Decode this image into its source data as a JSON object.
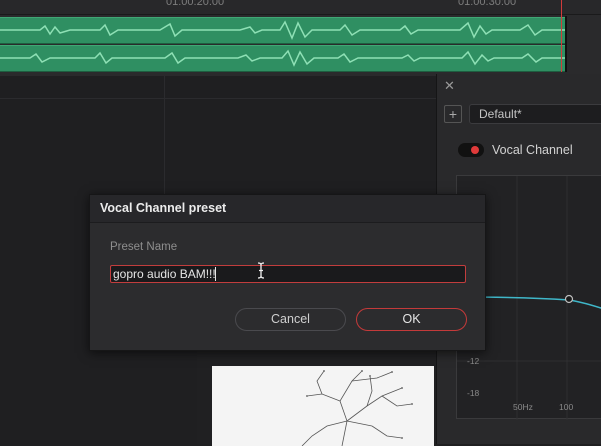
{
  "timeline": {
    "timecodes": [
      "01:00:20:00",
      "01:00:30:00"
    ],
    "track_color": "#2f8f62",
    "playhead_color": "#d03b3b"
  },
  "eq_panel": {
    "close_glyph": "✕",
    "add_glyph": "+",
    "preset_value": "Default*",
    "channel_name": "Vocal Channel",
    "toggle_on": true,
    "db_labels": [
      "-12",
      "-18"
    ],
    "freq_labels": [
      "50Hz",
      "100"
    ],
    "curve_color": "#3fb7c9"
  },
  "dialog": {
    "title": "Vocal Channel preset",
    "field_label": "Preset Name",
    "preset_name_value": "gopro audio BAM!!!",
    "cancel_label": "Cancel",
    "ok_label": "OK",
    "accent": "#c43a3a"
  },
  "icons": {
    "close": "close-icon",
    "add": "plus-icon",
    "cursor": "text-cursor-icon"
  }
}
